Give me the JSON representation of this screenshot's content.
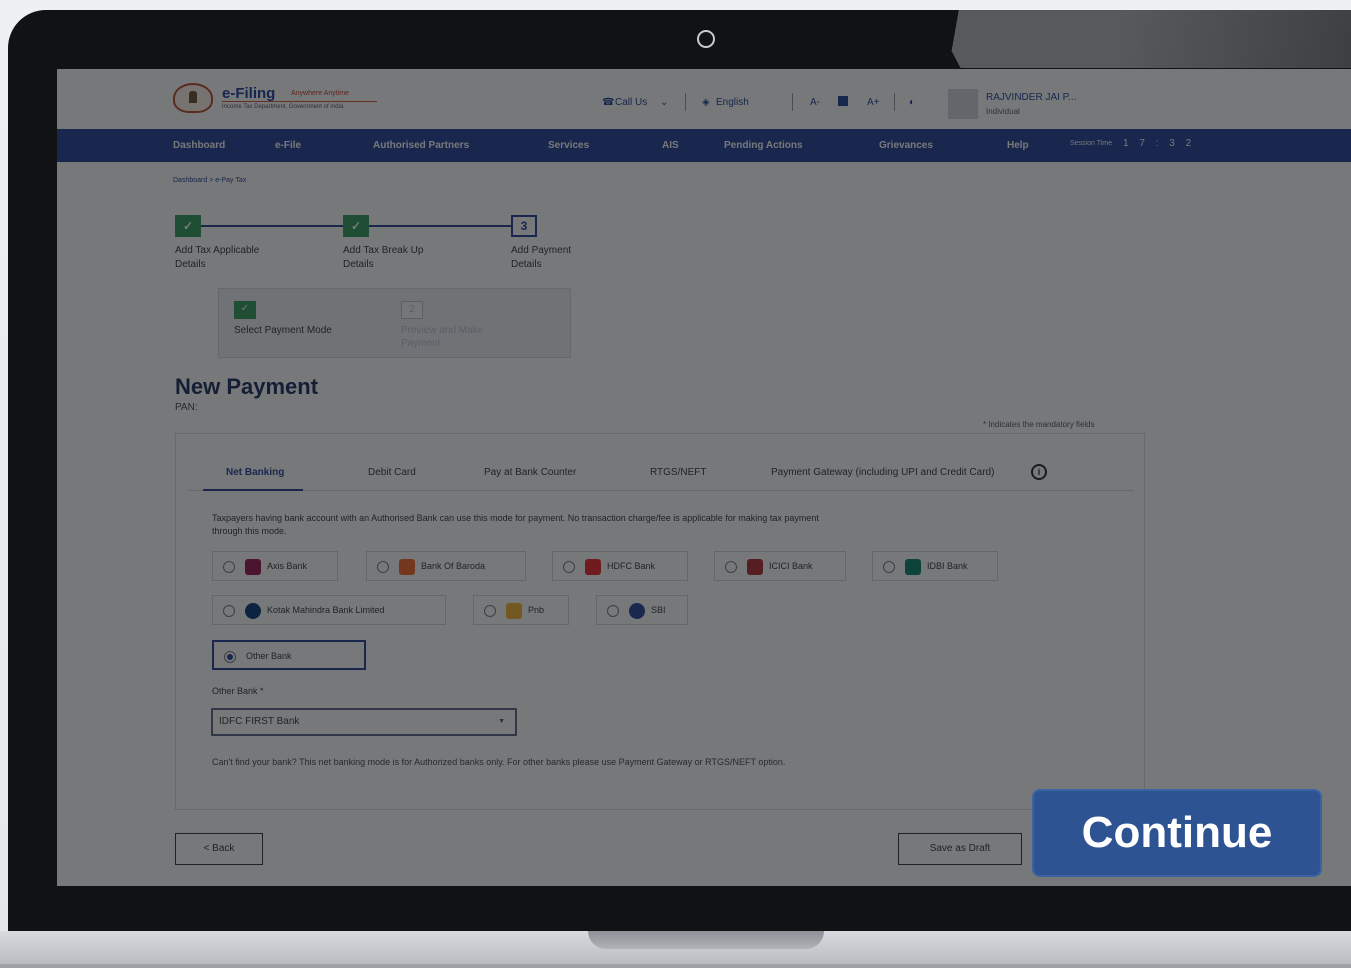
{
  "header": {
    "logo_text": "e-Filing",
    "logo_tagline": "Anywhere Anytime",
    "logo_subtitle": "Income Tax Department, Government of India",
    "call_us": "Call Us",
    "language": "English",
    "font_smaller": "A-",
    "font_larger": "A+",
    "user_name": "RAJVINDER JAI P...",
    "user_role": "Individual"
  },
  "nav": {
    "items": [
      "Dashboard",
      "e-File",
      "Authorised Partners",
      "Services",
      "AIS",
      "Pending Actions",
      "Grievances",
      "Help"
    ],
    "session_label": "Session Time",
    "session_time": "1 7 : 3 2"
  },
  "breadcrumb": "Dashboard > e-Pay Tax",
  "stepper": {
    "steps": [
      {
        "label": "Add Tax Applicable Details",
        "status": "done"
      },
      {
        "label": "Add Tax Break Up Details",
        "status": "done"
      },
      {
        "label": "Add Payment Details",
        "status": "current",
        "number": "3"
      }
    ],
    "substeps": [
      {
        "label": "Select Payment Mode",
        "status": "done"
      },
      {
        "label": "Preview and Make Payment",
        "status": "pending",
        "number": "2"
      }
    ]
  },
  "page": {
    "title": "New Payment",
    "pan_label": "PAN:",
    "mandatory_note": "* Indicates the mandatory fields"
  },
  "tabs": [
    "Net Banking",
    "Debit Card",
    "Pay at Bank Counter",
    "RTGS/NEFT",
    "Payment Gateway (including UPI and Credit Card)"
  ],
  "active_tab": "Net Banking",
  "description": "Taxpayers having bank account with an Authorised Bank can use this mode for payment. No transaction charge/fee is applicable for making tax payment through this mode.",
  "banks": [
    {
      "name": "Axis Bank",
      "color": "#97144d"
    },
    {
      "name": "Bank Of Baroda",
      "color": "#f26522"
    },
    {
      "name": "HDFC Bank",
      "color": "#ed232a"
    },
    {
      "name": "ICICI Bank",
      "color": "#b02a30"
    },
    {
      "name": "IDBI Bank",
      "color": "#00836c"
    },
    {
      "name": "Kotak Mahindra Bank Limited",
      "color": "#003874"
    },
    {
      "name": "Pnb",
      "color": "#f7b32b"
    },
    {
      "name": "SBI",
      "color": "#22409a"
    },
    {
      "name": "Other Bank",
      "selected": true
    }
  ],
  "other_bank": {
    "label": "Other Bank *",
    "value": "IDFC FIRST Bank"
  },
  "note": "Can't find your bank? This net banking mode is for Authorized banks only. For other banks please use Payment Gateway or RTGS/NEFT option.",
  "buttons": {
    "back": "< Back",
    "save_draft": "Save as Draft",
    "continue": "Continue"
  },
  "colors": {
    "primary": "#213e96",
    "success": "#2f9c5c",
    "continue_bg": "#2d5393"
  }
}
